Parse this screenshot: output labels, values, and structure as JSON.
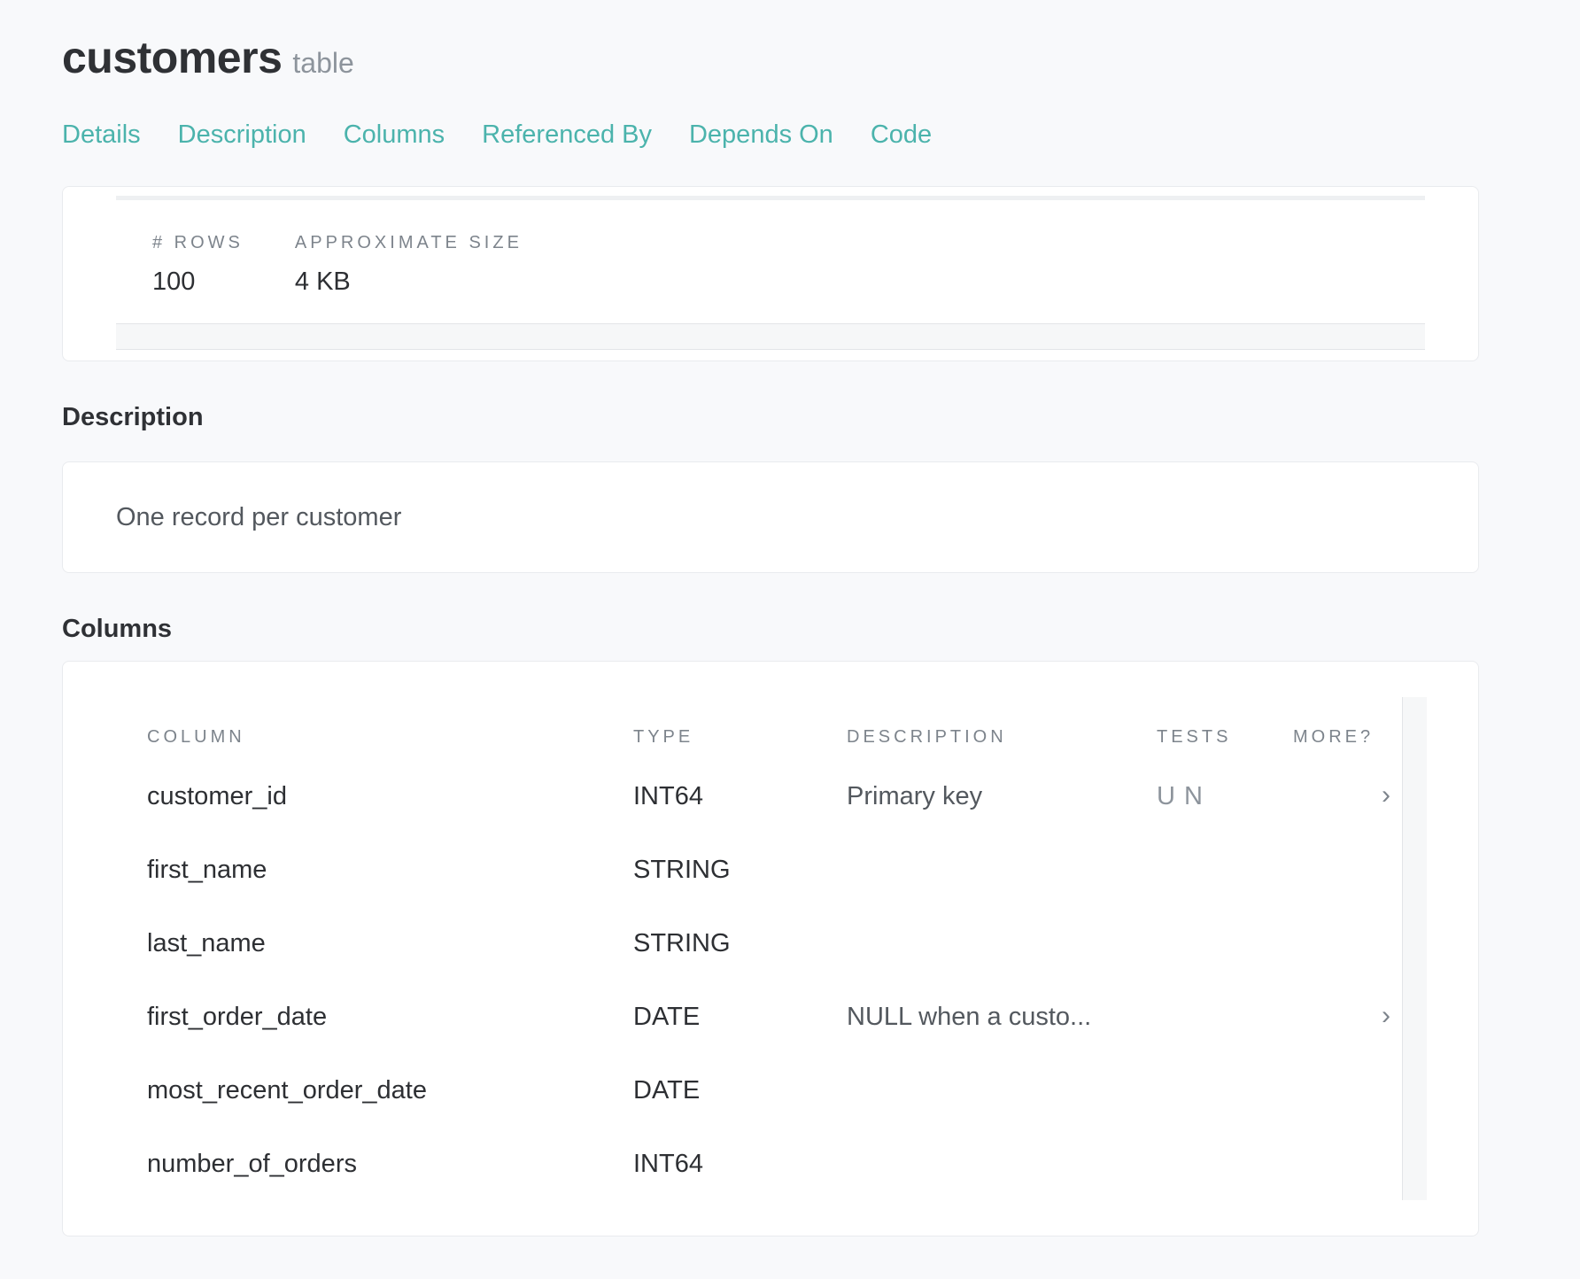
{
  "header": {
    "title": "customers",
    "subtitle": "table"
  },
  "tabs": [
    {
      "label": "Details"
    },
    {
      "label": "Description"
    },
    {
      "label": "Columns"
    },
    {
      "label": "Referenced By"
    },
    {
      "label": "Depends On"
    },
    {
      "label": "Code"
    }
  ],
  "details": {
    "stats": [
      {
        "label": "# ROWS",
        "value": "100"
      },
      {
        "label": "APPROXIMATE SIZE",
        "value": "4 KB"
      }
    ]
  },
  "description": {
    "heading": "Description",
    "text": "One record per customer"
  },
  "columns": {
    "heading": "Columns",
    "headers": {
      "column": "COLUMN",
      "type": "TYPE",
      "description": "DESCRIPTION",
      "tests": "TESTS",
      "more": "MORE?"
    },
    "rows": [
      {
        "name": "customer_id",
        "type": "INT64",
        "description": "Primary key",
        "tests": "U N",
        "more": "›"
      },
      {
        "name": "first_name",
        "type": "STRING",
        "description": "",
        "tests": "",
        "more": ""
      },
      {
        "name": "last_name",
        "type": "STRING",
        "description": "",
        "tests": "",
        "more": ""
      },
      {
        "name": "first_order_date",
        "type": "DATE",
        "description": "NULL when a custo...",
        "tests": "",
        "more": "›"
      },
      {
        "name": "most_recent_order_date",
        "type": "DATE",
        "description": "",
        "tests": "",
        "more": ""
      },
      {
        "name": "number_of_orders",
        "type": "INT64",
        "description": "",
        "tests": "",
        "more": ""
      }
    ]
  },
  "colors": {
    "accent": "#4bb3ac",
    "background": "#f8f9fb"
  }
}
